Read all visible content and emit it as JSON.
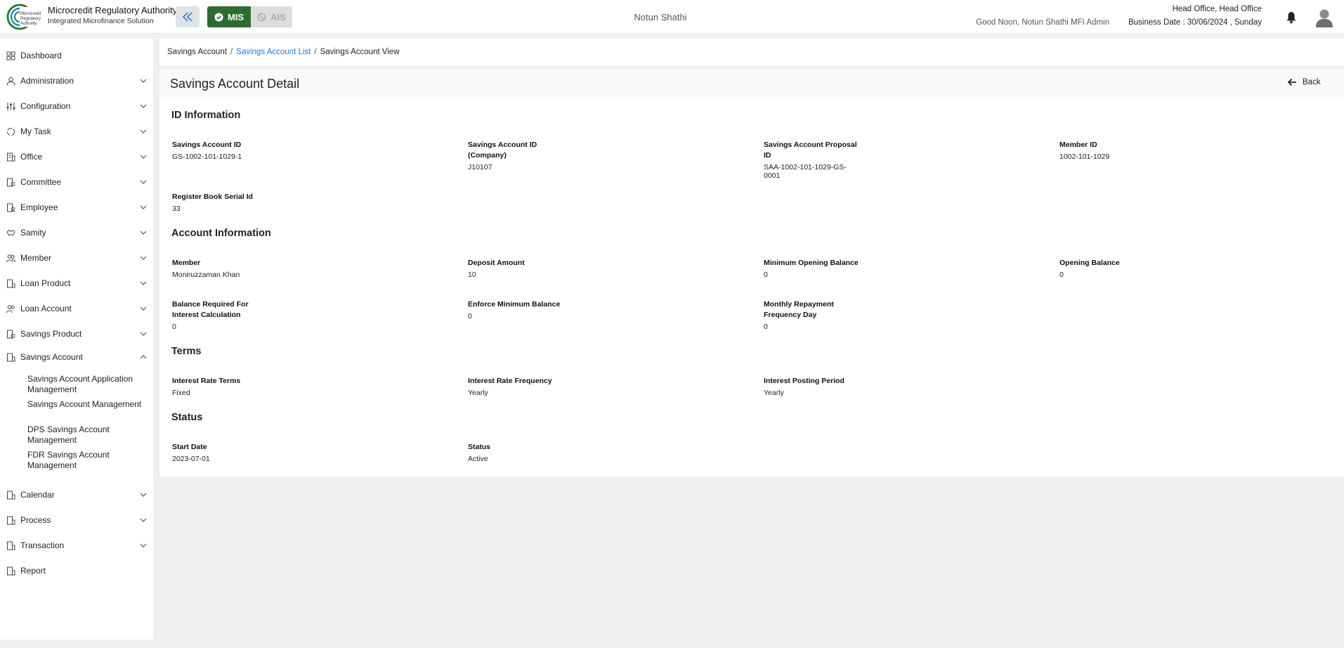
{
  "header": {
    "org_name": "Microcredit Regulatory Authority",
    "org_sub": "Integrated Microfinance Solution",
    "logo_text": "Microcredit Regulatory Authority",
    "mode_mis": "MIS",
    "mode_ais": "AIS",
    "center_title": "Notun Shathi",
    "greeting": "Good Noon, Notun Shathi MFI Admin",
    "office": "Head Office, Head Office",
    "business_date": "Business Date : 30/06/2024 , Sunday",
    "brand_color": "#2e6b30"
  },
  "sidebar": {
    "items": [
      {
        "label": "Dashboard",
        "chevron": false
      },
      {
        "label": "Administration",
        "chevron": true
      },
      {
        "label": "Configuration",
        "chevron": true
      },
      {
        "label": "My Task",
        "chevron": true
      },
      {
        "label": "Office",
        "chevron": true
      },
      {
        "label": "Committee",
        "chevron": true
      },
      {
        "label": "Employee",
        "chevron": true
      },
      {
        "label": "Samity",
        "chevron": true
      },
      {
        "label": "Member",
        "chevron": true
      },
      {
        "label": "Loan Product",
        "chevron": true
      },
      {
        "label": "Loan Account",
        "chevron": true
      },
      {
        "label": "Savings Product",
        "chevron": true
      },
      {
        "label": "Savings Account",
        "chevron": true,
        "expanded": true
      },
      {
        "label": "Calendar",
        "chevron": true
      },
      {
        "label": "Process",
        "chevron": true
      },
      {
        "label": "Transaction",
        "chevron": true
      },
      {
        "label": "Report",
        "chevron": false
      }
    ],
    "subitems": [
      "Savings Account Application Management",
      "Savings Account Management",
      "DPS Savings Account Management",
      "FDR Savings Account Management"
    ]
  },
  "breadcrumb": {
    "item1": "Savings Account",
    "item2": "Savings Account List",
    "item3": "Savings Account View",
    "sep": "/"
  },
  "page": {
    "title": "Savings Account Detail",
    "back_label": "Back"
  },
  "sections": {
    "id_info": {
      "title": "ID Information",
      "fields": [
        {
          "label": "Savings Account ID",
          "value": "GS-1002-101-1029-1"
        },
        {
          "label": "Savings Account ID (Company)",
          "value": "J10107"
        },
        {
          "label": "Savings Account Proposal ID",
          "value": "SAA-1002-101-1029-GS-0001"
        },
        {
          "label": "Member ID",
          "value": "1002-101-1029"
        },
        {
          "label": "Register Book Serial Id",
          "value": "33"
        }
      ]
    },
    "account_info": {
      "title": "Account Information",
      "fields": [
        {
          "label": "Member",
          "value": "Moniruzzaman Khan"
        },
        {
          "label": "Deposit Amount",
          "value": "10"
        },
        {
          "label": "Minimum Opening Balance",
          "value": "0"
        },
        {
          "label": "Opening Balance",
          "value": "0"
        },
        {
          "label": "Balance Required For Interest Calculation",
          "value": "0"
        },
        {
          "label": "Enforce Minimum Balance",
          "value": "0"
        },
        {
          "label": "Monthly Repayment Frequency Day",
          "value": "0"
        }
      ]
    },
    "terms": {
      "title": "Terms",
      "fields": [
        {
          "label": "Interest Rate Terms",
          "value": "Fixed"
        },
        {
          "label": "Interest Rate Frequency",
          "value": "Yearly"
        },
        {
          "label": "Interest Posting Period",
          "value": "Yearly"
        }
      ]
    },
    "status": {
      "title": "Status",
      "fields": [
        {
          "label": "Start Date",
          "value": "2023-07-01"
        },
        {
          "label": "Status",
          "value": "Active"
        }
      ]
    }
  }
}
